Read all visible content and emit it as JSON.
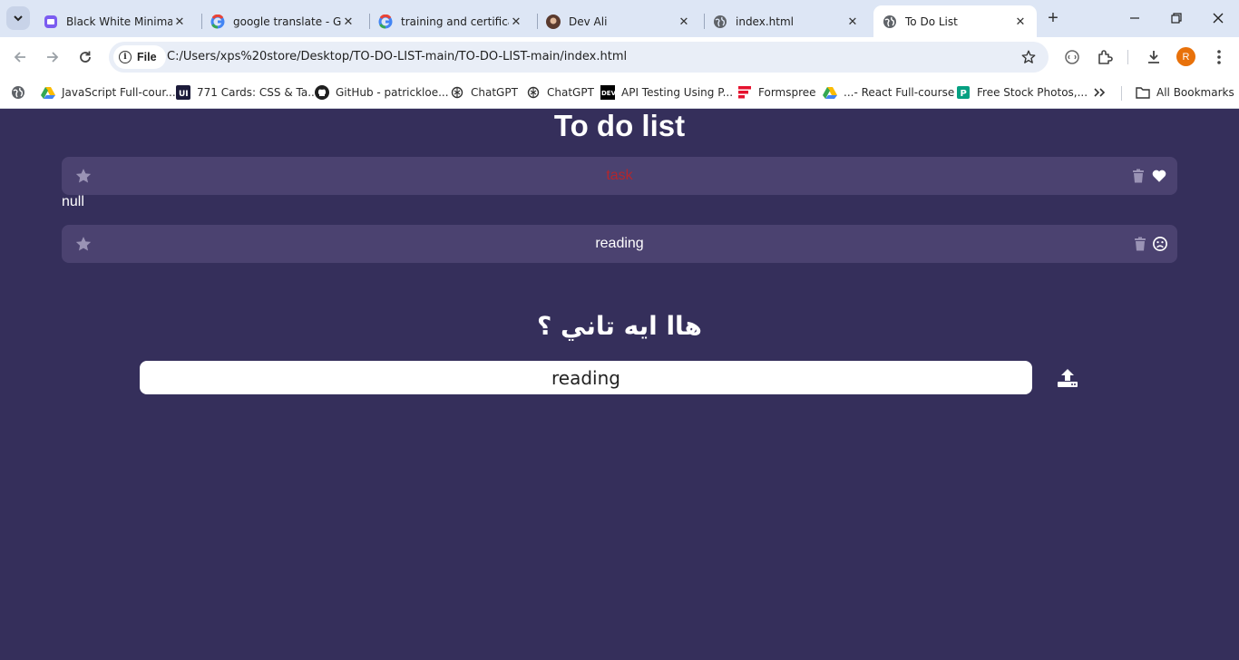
{
  "browser": {
    "tabs": [
      {
        "title": "Black White Minimalis",
        "favicon": "canva-icon",
        "active": false
      },
      {
        "title": "google translate - Go",
        "favicon": "google-icon",
        "active": false
      },
      {
        "title": "training and certificat",
        "favicon": "google-icon",
        "active": false
      },
      {
        "title": "Dev Ali",
        "favicon": "avatar-icon",
        "active": false
      },
      {
        "title": "index.html",
        "favicon": "globe-icon",
        "active": false
      },
      {
        "title": "To Do List",
        "favicon": "globe-icon",
        "active": true
      }
    ],
    "site_chip": "File",
    "url": "C:/Users/xps%20store/Desktop/TO-DO-LIST-main/TO-DO-LIST-main/index.html",
    "profile_initial": "R",
    "bookmarks": [
      {
        "label": "JavaScript Full-cour...",
        "icon": "drive-icon"
      },
      {
        "label": "771 Cards: CSS & Ta...",
        "icon": "uiverse-icon"
      },
      {
        "label": "GitHub - patrickloe...",
        "icon": "github-icon"
      },
      {
        "label": "ChatGPT",
        "icon": "chatgpt-icon"
      },
      {
        "label": "ChatGPT",
        "icon": "chatgpt-icon"
      },
      {
        "label": "API Testing Using P...",
        "icon": "dev-icon"
      },
      {
        "label": "Formspree",
        "icon": "formspree-icon"
      },
      {
        "label": "...- React Full-course",
        "icon": "drive-icon"
      },
      {
        "label": "Free Stock Photos,...",
        "icon": "pexels-icon"
      }
    ],
    "all_bookmarks": "All Bookmarks"
  },
  "app": {
    "title": "To do list",
    "tasks": [
      {
        "text": "task",
        "color": "#b3262d",
        "status_icon": "heart-icon"
      },
      {
        "text": "reading",
        "color": "#ffffff",
        "status_icon": "sad-face-icon"
      }
    ],
    "null_text": "null",
    "subheading": "هاا ايه تاني ؟",
    "input_value": "reading",
    "colors": {
      "background": "#352f5b",
      "row": "#4b4270",
      "icon_muted": "#9a93b5"
    }
  }
}
